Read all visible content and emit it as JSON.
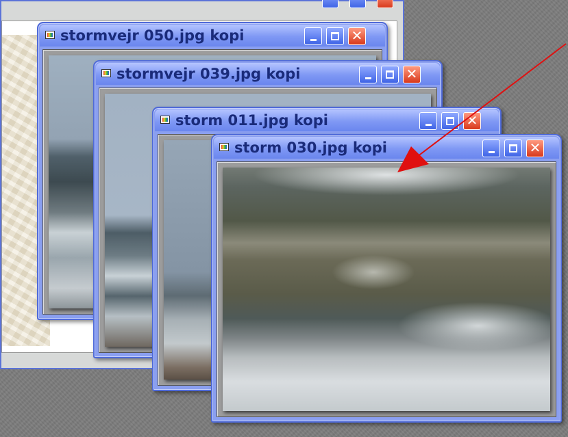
{
  "windows": [
    {
      "title": "stormvejr 050.jpg kopi"
    },
    {
      "title": "stormvejr 039.jpg kopi"
    },
    {
      "title": "storm 011.jpg kopi"
    },
    {
      "title": "storm 030.jpg kopi"
    }
  ],
  "colors": {
    "titlebar": "#7f98f4",
    "title_text": "#1a2b7a",
    "close_button": "#d8391c",
    "arrow": "#e01010",
    "desktop": "#7c7c7c"
  },
  "icons": [
    "image-file-icon",
    "minimize-icon",
    "maximize-icon",
    "close-icon"
  ]
}
